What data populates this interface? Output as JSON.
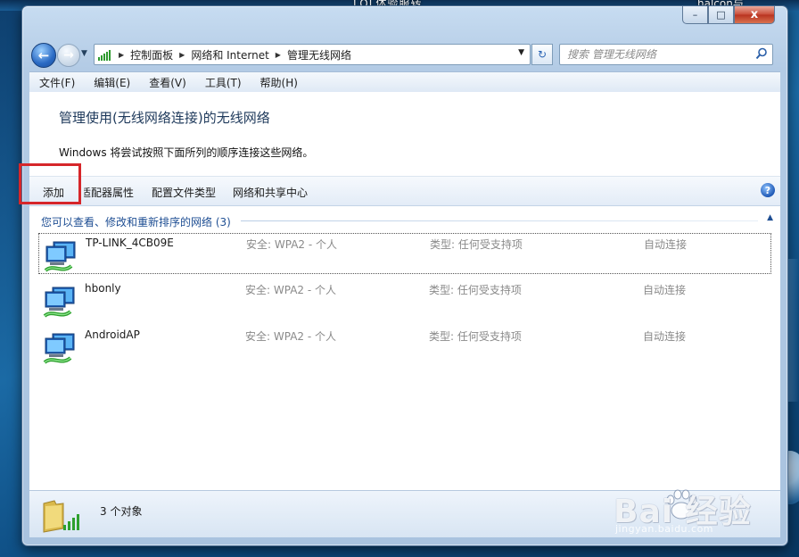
{
  "desktop": {
    "top_text": "LOL体验服转",
    "top_right_text": "halcon与"
  },
  "window": {
    "caption": {
      "minimize": "–",
      "maximize": "□",
      "close": "x"
    }
  },
  "address": {
    "back_glyph": "←",
    "forward_glyph": "→",
    "history_dropdown": "▼",
    "breadcrumb": [
      "控制面板",
      "网络和 Internet",
      "管理无线网络"
    ],
    "dropdown_glyph": "▼",
    "refresh_glyph": "↻"
  },
  "search": {
    "placeholder": "搜索 管理无线网络"
  },
  "menu": [
    "文件(F)",
    "编辑(E)",
    "查看(V)",
    "工具(T)",
    "帮助(H)"
  ],
  "page": {
    "title": "管理使用(无线网络连接)的无线网络",
    "description": "Windows 将尝试按照下面所列的顺序连接这些网络。"
  },
  "commands": {
    "add": "添加",
    "adapter_properties": "适配器属性",
    "profile_types": "配置文件类型",
    "sharing_center": "网络和共享中心",
    "help_glyph": "?"
  },
  "list": {
    "header": "您可以查看、修改和重新排序的网络 (3)",
    "collapse_glyph": "▲",
    "networks": [
      {
        "name": "TP-LINK_4CB09E",
        "security": "安全: WPA2 - 个人",
        "type": "类型: 任何受支持项",
        "mode": "自动连接"
      },
      {
        "name": "hbonly",
        "security": "安全: WPA2 - 个人",
        "type": "类型: 任何受支持项",
        "mode": "自动连接"
      },
      {
        "name": "AndroidAP",
        "security": "安全: WPA2 - 个人",
        "type": "类型: 任何受支持项",
        "mode": "自动连接"
      }
    ]
  },
  "status": {
    "text": "3 个对象"
  },
  "watermark": {
    "logo": "Bai  经验",
    "url": "jingyan.baidu.com"
  },
  "colors": {
    "highlight_box": "#d6262a",
    "title_blue": "#1e395b",
    "link_blue": "#1e4e93"
  }
}
